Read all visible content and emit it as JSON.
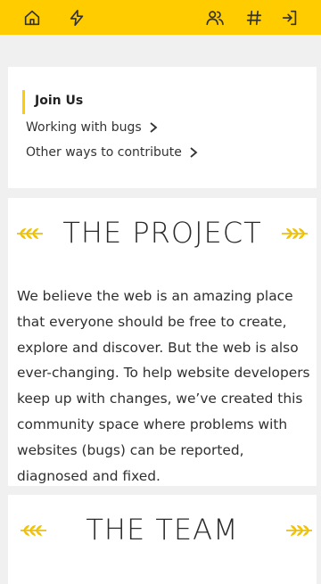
{
  "topbar": {
    "icons": [
      "home-icon",
      "lightning-icon",
      "users-icon",
      "hashtag-icon",
      "sign-in-icon"
    ],
    "accent": "#ffcc00"
  },
  "menu": {
    "active_label": "Join Us",
    "items": [
      {
        "label": "Working with bugs"
      },
      {
        "label": "Other ways to contribute"
      }
    ]
  },
  "project": {
    "title": "THE PROJECT",
    "body": "We believe the web is an amazing place that everyone should be free to create, explore and discover. But the web is also ever-changing. To help website developers keep up with changes, we’ve created this community space where problems with websites (bugs) can be reported, diagnosed and fixed."
  },
  "team": {
    "title": "THE TEAM"
  }
}
